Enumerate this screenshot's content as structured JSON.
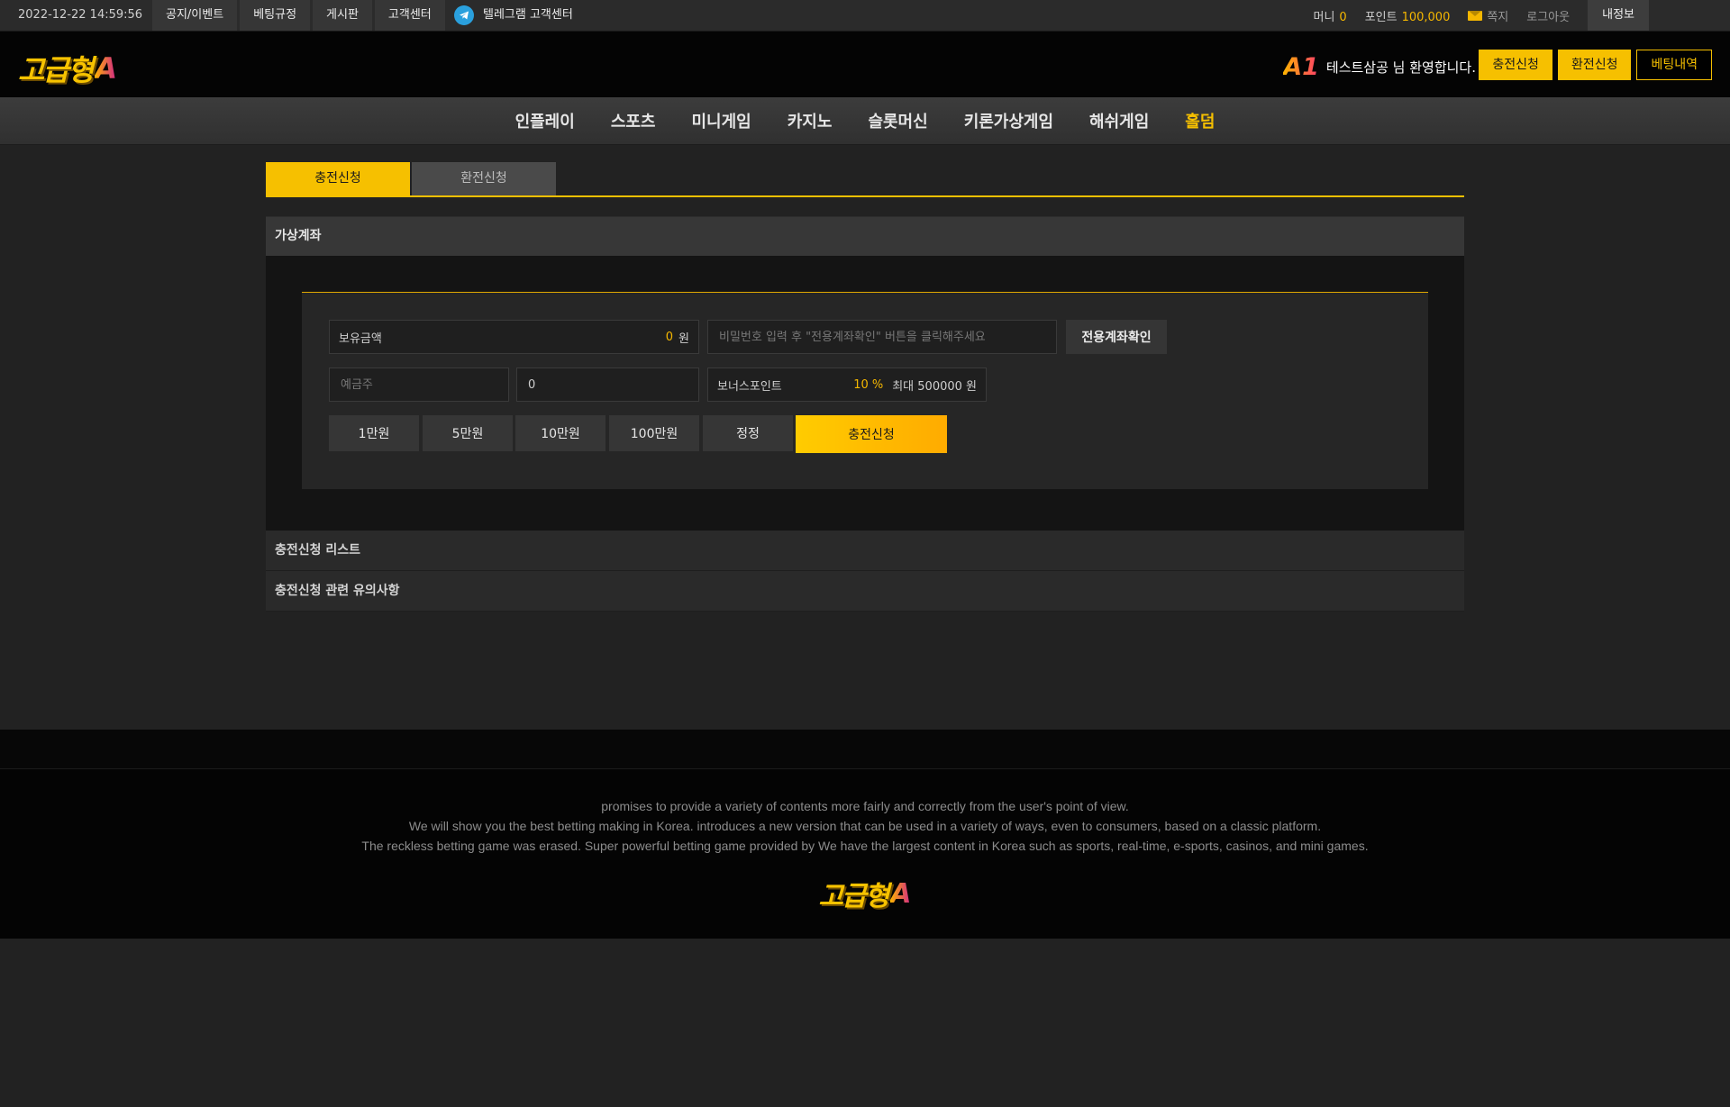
{
  "topbar": {
    "datetime": "2022-12-22 14:59:56",
    "links": [
      "공지/이벤트",
      "베팅규정",
      "게시판",
      "고객센터"
    ],
    "telegram_label": "텔레그램 고객센터",
    "money_label": "머니",
    "money_value": "0",
    "point_label": "포인트",
    "point_value": "100,000",
    "message_label": "쪽지",
    "logout_label": "로그아웃",
    "myinfo_label": "내정보"
  },
  "header": {
    "logo_text": "고급형",
    "logo_mark": "A",
    "level_badge": "A1",
    "welcome": "테스트삼공 님 환영합니다.",
    "buttons": {
      "deposit": "충전신청",
      "withdraw": "환전신청",
      "betting_history": "베팅내역"
    }
  },
  "nav": {
    "items": [
      "인플레이",
      "스포츠",
      "미니게임",
      "카지노",
      "슬롯머신",
      "키론가상게임",
      "해쉬게임",
      "홀덤"
    ]
  },
  "tabs": {
    "deposit": "충전신청",
    "withdraw": "환전신청"
  },
  "virtual_account": {
    "title": "가상계좌",
    "balance_label": "보유금액",
    "balance_value": "0",
    "balance_unit": "원",
    "password_placeholder": "비밀번호 입력 후 \"전용계좌확인\" 버튼을 클릭해주세요",
    "check_button": "전용계좌확인",
    "depositor_placeholder": "예금주",
    "amount_value": "0",
    "bonus_label": "보너스포인트",
    "bonus_value": "10 %",
    "bonus_max": "최대 500000 원",
    "amount_buttons": [
      "1만원",
      "5만원",
      "10만원",
      "100만원",
      "정정"
    ],
    "apply_button": "충전신청"
  },
  "sections": {
    "list_title": "충전신청 리스트",
    "notice_title": "충전신청 관련 유의사항"
  },
  "footer": {
    "lines": [
      "promises to provide a variety of contents more fairly and correctly from the user's point of view.",
      "We will show you the best betting making in Korea. introduces a new version that can be used in a variety of ways, even to consumers, based on a classic platform.",
      "The reckless betting game was erased. Super powerful betting game provided by  We have the largest content in Korea such as sports, real-time, e-sports, casinos, and mini games."
    ],
    "logo_text": "고급형",
    "logo_mark": "A"
  },
  "colors": {
    "accent": "#f6c000",
    "background": "#222222",
    "header": "#040404"
  }
}
